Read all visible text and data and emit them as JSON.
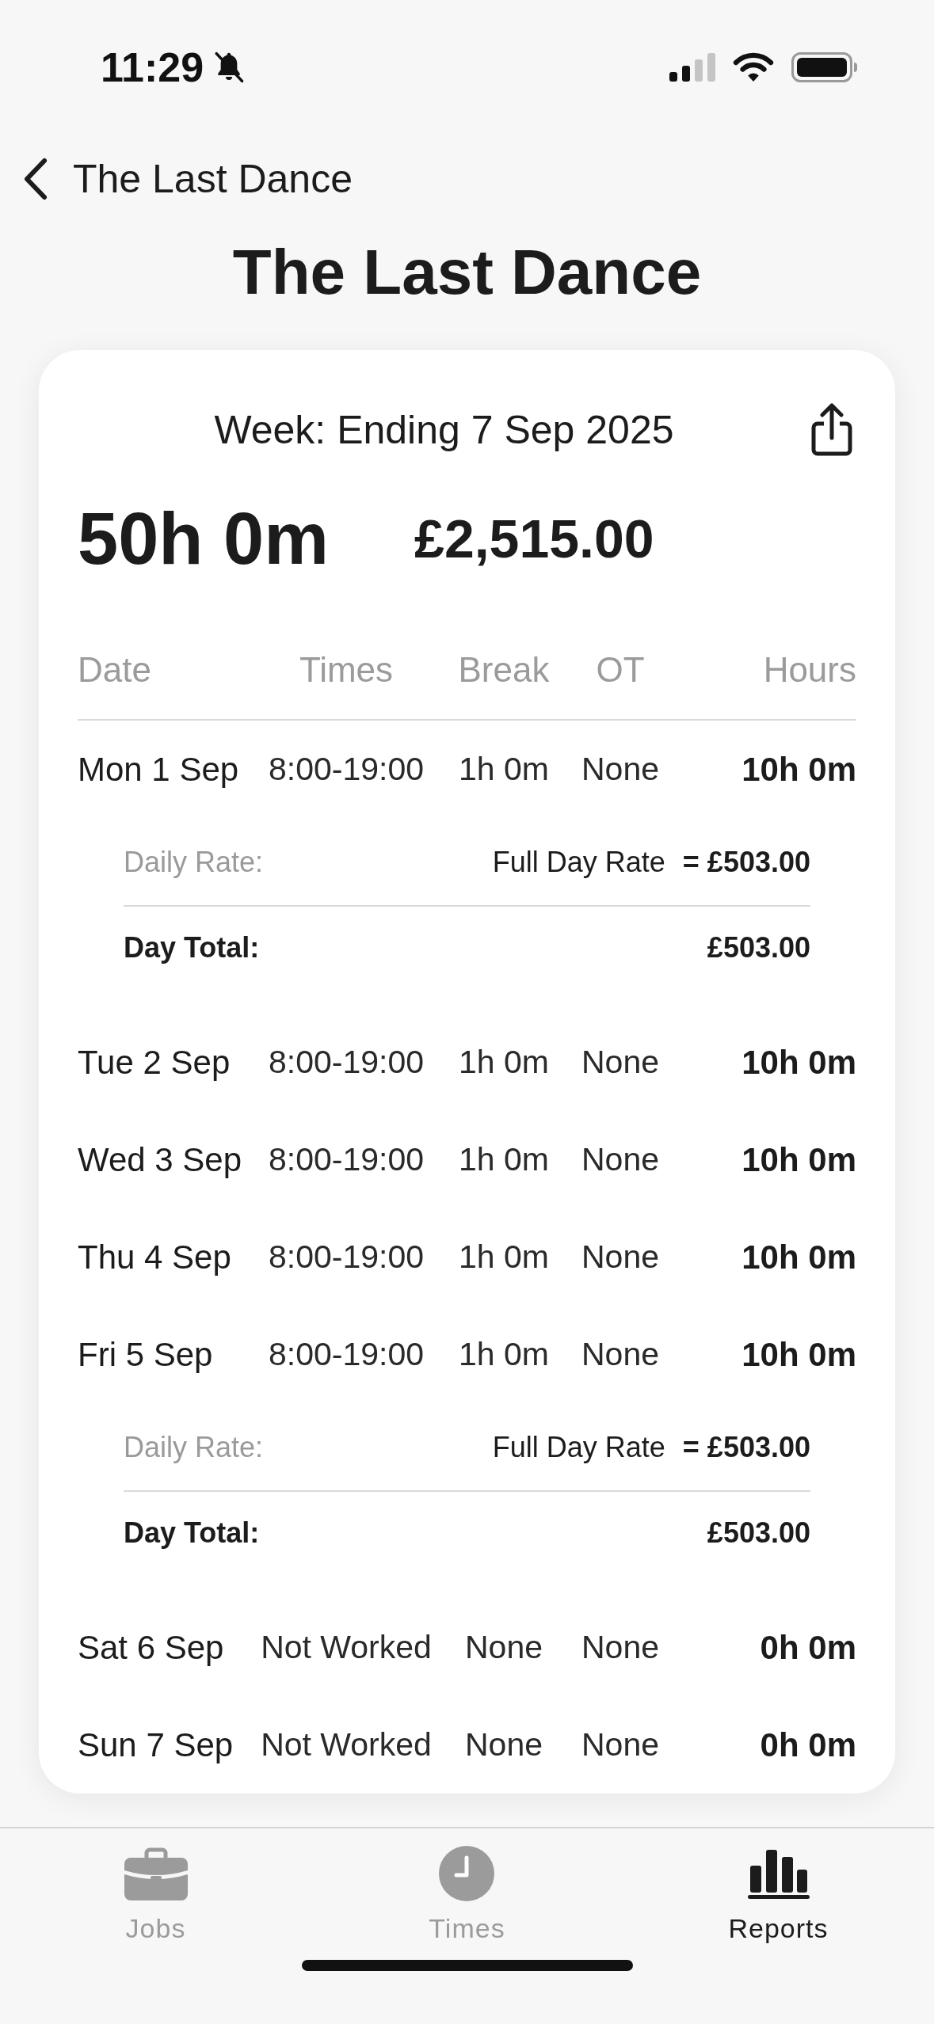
{
  "status_bar": {
    "time": "11:29"
  },
  "nav": {
    "back_label": "The Last Dance",
    "title": "The Last Dance"
  },
  "report": {
    "week": "Week: Ending 7 Sep 2025",
    "total_hours": "50h 0m",
    "total_pay": "£2,515.00",
    "columns": [
      "Date",
      "Times",
      "Break",
      "OT",
      "Hours"
    ],
    "days": [
      {
        "date": "Mon 1 Sep",
        "times": "8:00-19:00",
        "break": "1h 0m",
        "ot": "None",
        "hours": "10h 0m",
        "rate": {
          "label": "Daily Rate:",
          "type": "Full Day Rate",
          "amount": "= £503.00",
          "total_label": "Day Total:",
          "total": "£503.00"
        }
      },
      {
        "date": "Tue 2 Sep",
        "times": "8:00-19:00",
        "break": "1h 0m",
        "ot": "None",
        "hours": "10h 0m"
      },
      {
        "date": "Wed 3 Sep",
        "times": "8:00-19:00",
        "break": "1h 0m",
        "ot": "None",
        "hours": "10h 0m"
      },
      {
        "date": "Thu 4 Sep",
        "times": "8:00-19:00",
        "break": "1h 0m",
        "ot": "None",
        "hours": "10h 0m"
      },
      {
        "date": "Fri 5 Sep",
        "times": "8:00-19:00",
        "break": "1h 0m",
        "ot": "None",
        "hours": "10h 0m",
        "rate": {
          "label": "Daily Rate:",
          "type": "Full Day Rate",
          "amount": "= £503.00",
          "total_label": "Day Total:",
          "total": "£503.00"
        }
      },
      {
        "date": "Sat 6 Sep",
        "times": "Not Worked",
        "break": "None",
        "ot": "None",
        "hours": "0h 0m"
      },
      {
        "date": "Sun 7 Sep",
        "times": "Not Worked",
        "break": "None",
        "ot": "None",
        "hours": "0h 0m"
      }
    ]
  },
  "tab_bar": [
    {
      "label": "Jobs",
      "selected": false
    },
    {
      "label": "Times",
      "selected": false
    },
    {
      "label": "Reports",
      "selected": true
    }
  ]
}
